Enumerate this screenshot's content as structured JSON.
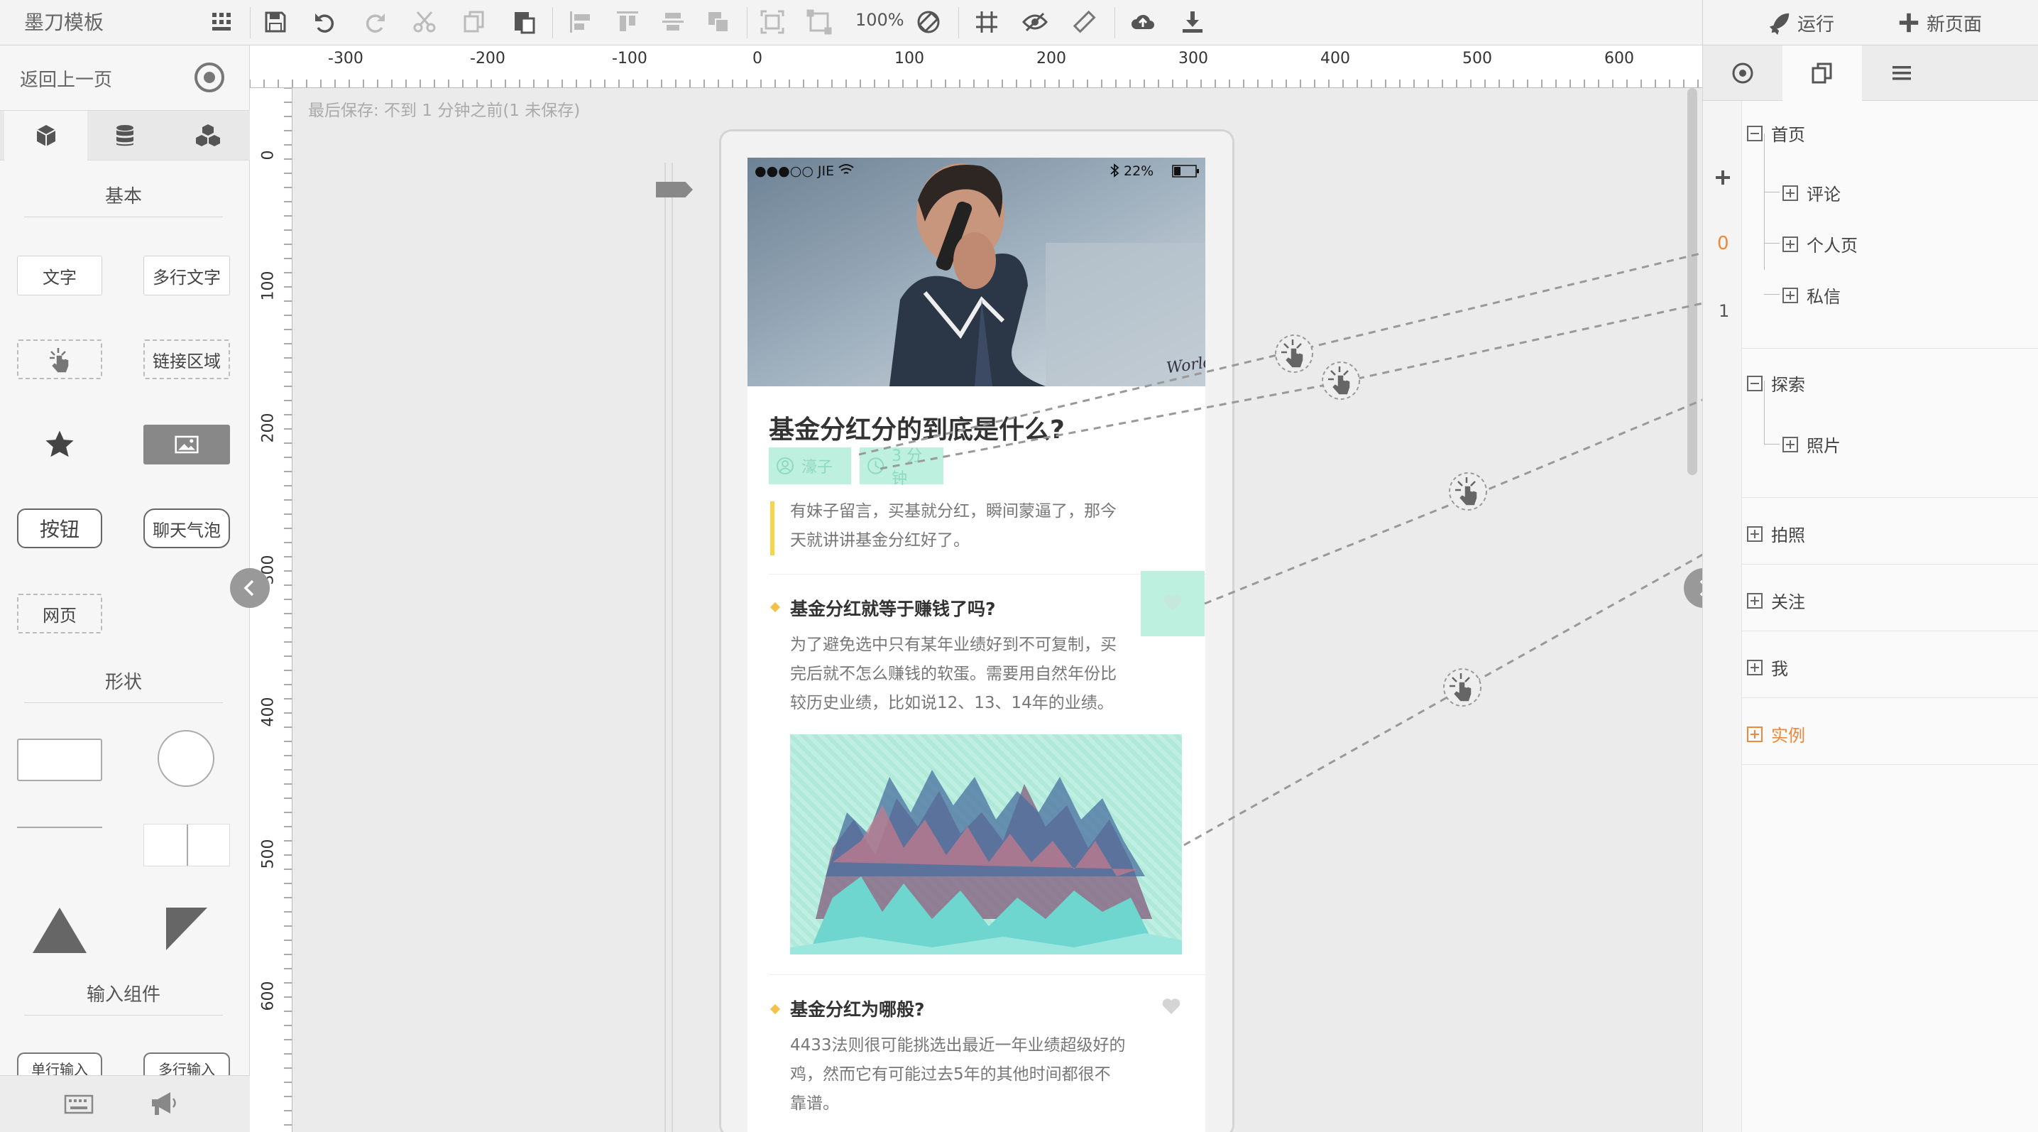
{
  "app": {
    "title": "墨刀模板"
  },
  "toolbar": {
    "zoom": "100%",
    "run_label": "运行",
    "new_page_label": "新页面"
  },
  "left_panel": {
    "back_label": "返回上一页",
    "sections": {
      "basic": "基本",
      "shapes": "形状",
      "input": "输入组件"
    },
    "components": {
      "text": "文字",
      "multiline_text": "多行文字",
      "link_area": "链接区域",
      "button": "按钮",
      "chat_bubble": "聊天气泡",
      "webpage": "网页",
      "single_input": "单行输入",
      "multi_input": "多行输入"
    }
  },
  "ruler": {
    "h_labels": [
      "-300",
      "-200",
      "-100",
      "0",
      "100",
      "200",
      "300",
      "400",
      "500",
      "600"
    ],
    "v_labels": [
      "0",
      "100",
      "200",
      "300",
      "400",
      "500",
      "600"
    ]
  },
  "canvas": {
    "save_status": "最后保存: 不到 1 分钟之前(1 未保存)"
  },
  "phone": {
    "status": {
      "carrier": "●●●○○ JIE",
      "battery": "22%"
    },
    "hero_caption": "World",
    "article": {
      "title": "基金分红分的到底是什么?",
      "author": "濠子",
      "read_time": "3 分钟",
      "intro_line1": "有妹子留言，买基就分红，瞬间蒙逼了，那今",
      "intro_line2": "天就讲讲基金分红好了。",
      "q1_title": "基金分红就等于赚钱了吗?",
      "q1_line1": "为了避免选中只有某年业绩好到不可复制，买",
      "q1_line2": "完后就不怎么赚钱的软蛋。需要用自然年份比",
      "q1_line3": "较历史业绩，比如说12、13、14年的业绩。",
      "q2_title": "基金分红为哪般?",
      "q2_line1": "4433法则很可能挑选出最近一年业绩超级好的",
      "q2_line2": "鸡，然而它有可能过去5年的其他时间都很不",
      "q2_line3": "靠谱。"
    }
  },
  "right_panel": {
    "gutter": {
      "count_orange": "0",
      "count": "1"
    },
    "pages": [
      {
        "label": "首页"
      },
      {
        "label": "评论"
      },
      {
        "label": "个人页"
      },
      {
        "label": "私信"
      },
      {
        "label": "探索"
      },
      {
        "label": "照片"
      },
      {
        "label": "拍照"
      },
      {
        "label": "关注"
      },
      {
        "label": "我"
      },
      {
        "label": "实例"
      }
    ]
  },
  "colors": {
    "accent_orange": "#f0883a",
    "highlight_teal": "#bdf0df",
    "quote_yellow": "#f5d64a"
  }
}
